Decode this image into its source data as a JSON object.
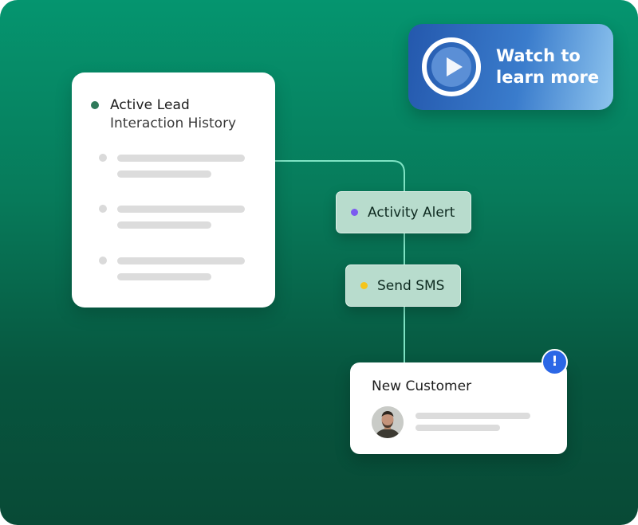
{
  "lead_card": {
    "title": "Active Lead",
    "subtitle": "Interaction History",
    "status_color": "#2f7a5a",
    "placeholder_rows": 3
  },
  "watch_card": {
    "text": "Watch to learn more",
    "icon": "play-icon"
  },
  "workflow": {
    "steps": [
      {
        "label": "Activity Alert",
        "dot_color": "#7b5bf0"
      },
      {
        "label": "Send SMS",
        "dot_color": "#f5c51b"
      }
    ]
  },
  "customer_card": {
    "title": "New Customer",
    "avatar": "avatar",
    "alert_symbol": "!",
    "alert_color": "#2b67e6"
  },
  "colors": {
    "background_top": "#05956f",
    "background_bottom": "#084a36",
    "connector": "#7fe3c4"
  }
}
